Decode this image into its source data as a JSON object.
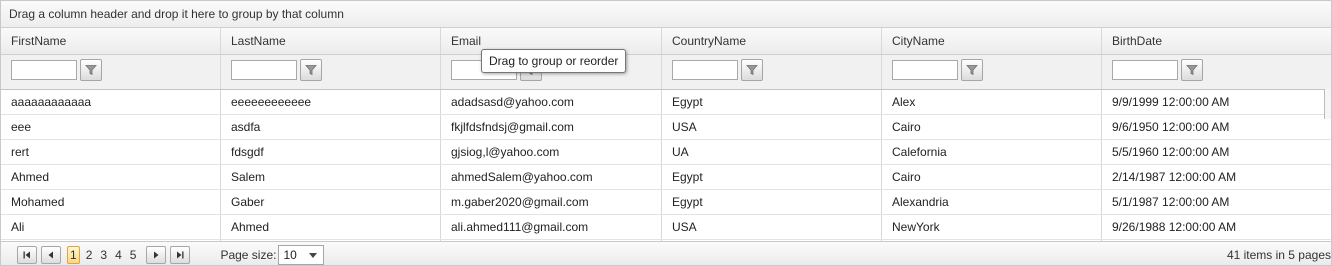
{
  "group_panel_text": "Drag a column header and drop it here to group by that column",
  "columns": [
    "FirstName",
    "LastName",
    "Email",
    "CountryName",
    "CityName",
    "BirthDate"
  ],
  "rows": [
    [
      "aaaaaaaaaaaa",
      "eeeeeeeeeeee",
      "adadsasd@yahoo.com",
      "Egypt",
      "Alex",
      "9/9/1999 12:00:00 AM"
    ],
    [
      "eee",
      "asdfa",
      "fkjlfdsfndsj@gmail.com",
      "USA",
      "Cairo",
      "9/6/1950 12:00:00 AM"
    ],
    [
      "rert",
      "fdsgdf",
      "gjsiog,l@yahoo.com",
      "UA",
      "Calefornia",
      "5/5/1960 12:00:00 AM"
    ],
    [
      "Ahmed",
      "Salem",
      "ahmedSalem@yahoo.com",
      "Egypt",
      "Cairo",
      "2/14/1987 12:00:00 AM"
    ],
    [
      "Mohamed",
      "Gaber",
      "m.gaber2020@gmail.com",
      "Egypt",
      "Alexandria",
      "5/1/1987 12:00:00 AM"
    ],
    [
      "Ali",
      "Ahmed",
      "ali.ahmed111@gmail.com",
      "USA",
      "NewYork",
      "9/26/1988 12:00:00 AM"
    ]
  ],
  "tooltip": "Drag to group or reorder",
  "pager": {
    "pages": [
      "1",
      "2",
      "3",
      "4",
      "5"
    ],
    "current_page": "1",
    "page_size_label": "Page size:",
    "page_size": "10",
    "items_info": "41 items in 5 pages"
  },
  "icons": {
    "filter": "filter-icon",
    "first": "first-page-icon",
    "prev": "prev-page-icon",
    "next": "next-page-icon",
    "last": "last-page-icon"
  },
  "colors": {
    "active_page_border": "#e0a341",
    "active_page_fill": "#ffd680"
  }
}
